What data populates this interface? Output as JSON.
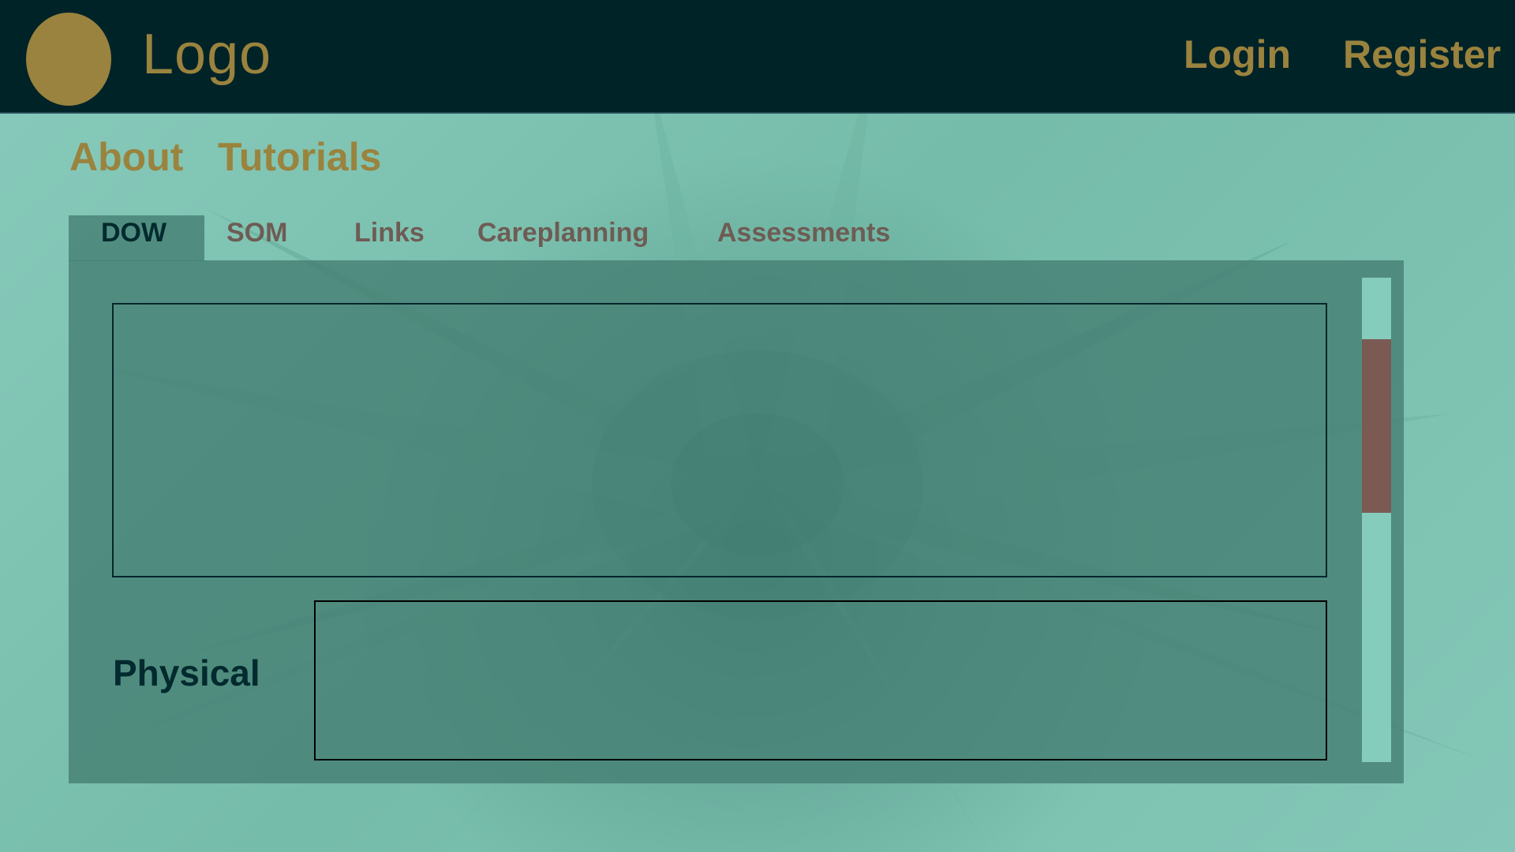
{
  "header": {
    "logo_text": "Logo",
    "login_label": "Login",
    "register_label": "Register"
  },
  "subnav": {
    "about_label": "About",
    "tutorials_label": "Tutorials"
  },
  "tabs": [
    {
      "label": "DOW",
      "active": true
    },
    {
      "label": "SOM",
      "active": false
    },
    {
      "label": "Links",
      "active": false
    },
    {
      "label": "Careplanning",
      "active": false
    },
    {
      "label": "Assessments",
      "active": false
    }
  ],
  "main": {
    "physical_label": "Physical"
  },
  "colors": {
    "topbar_bg": "#002328",
    "gold_accent": "#9a833e",
    "inactive_tab_text": "#6e5c54",
    "active_tab_text": "#032a2e",
    "panel_bg": "#468074",
    "scroll_track": "#86ccbc",
    "scroll_thumb": "#7a5a52"
  }
}
